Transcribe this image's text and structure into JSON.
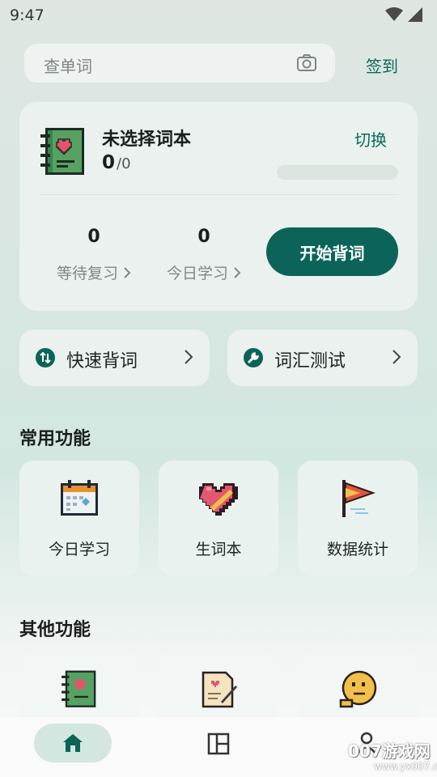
{
  "status": {
    "time": "9:47"
  },
  "search": {
    "placeholder": "查单词",
    "signin": "签到"
  },
  "book": {
    "title": "未选择词本",
    "learned": "0",
    "total": "/0",
    "switch": "切换",
    "progress": 0
  },
  "stats": [
    {
      "value": "0",
      "label": "等待复习"
    },
    {
      "value": "0",
      "label": "今日学习"
    }
  ],
  "start_button": "开始背词",
  "quick": [
    {
      "label": "快速背词",
      "icon": "swap-icon"
    },
    {
      "label": "词汇测试",
      "icon": "wrench-icon"
    }
  ],
  "sections": {
    "common": "常用功能",
    "other": "其他功能"
  },
  "common_tiles": [
    {
      "label": "今日学习",
      "icon": "calendar-icon"
    },
    {
      "label": "生词本",
      "icon": "heart-book-icon"
    },
    {
      "label": "数据统计",
      "icon": "flag-icon"
    }
  ],
  "other_tiles": [
    {
      "icon": "notebook-icon"
    },
    {
      "icon": "letter-icon"
    },
    {
      "icon": "thinking-face-icon"
    }
  ],
  "nav": {
    "home": "home-icon",
    "layout": "layout-icon",
    "profile": "profile-icon"
  },
  "watermark": {
    "text": "007游戏网",
    "url": "www.yx007.com"
  },
  "colors": {
    "accent": "#0b6457",
    "card": "#eaf1ee"
  }
}
